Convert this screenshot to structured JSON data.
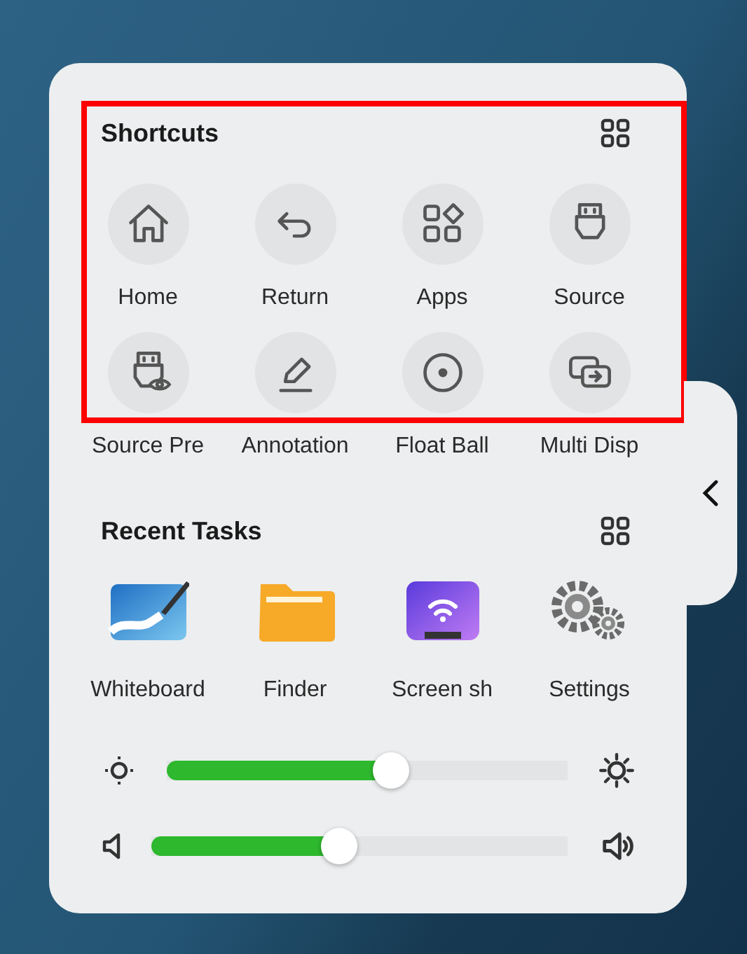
{
  "shortcuts": {
    "title": "Shortcuts",
    "highlighted": true,
    "items": [
      {
        "label": "Home"
      },
      {
        "label": "Return"
      },
      {
        "label": "Apps"
      },
      {
        "label": "Source"
      },
      {
        "label": "Source Pre"
      },
      {
        "label": "Annotation"
      },
      {
        "label": "Float Ball"
      },
      {
        "label": "Multi Disp"
      }
    ]
  },
  "recent_tasks": {
    "title": "Recent Tasks",
    "items": [
      {
        "label": "Whiteboard"
      },
      {
        "label": "Finder"
      },
      {
        "label": "Screen sh"
      },
      {
        "label": "Settings"
      }
    ]
  },
  "sliders": [
    {
      "kind": "brightness",
      "level": 0.56
    },
    {
      "kind": "volume",
      "level": 0.45
    }
  ]
}
